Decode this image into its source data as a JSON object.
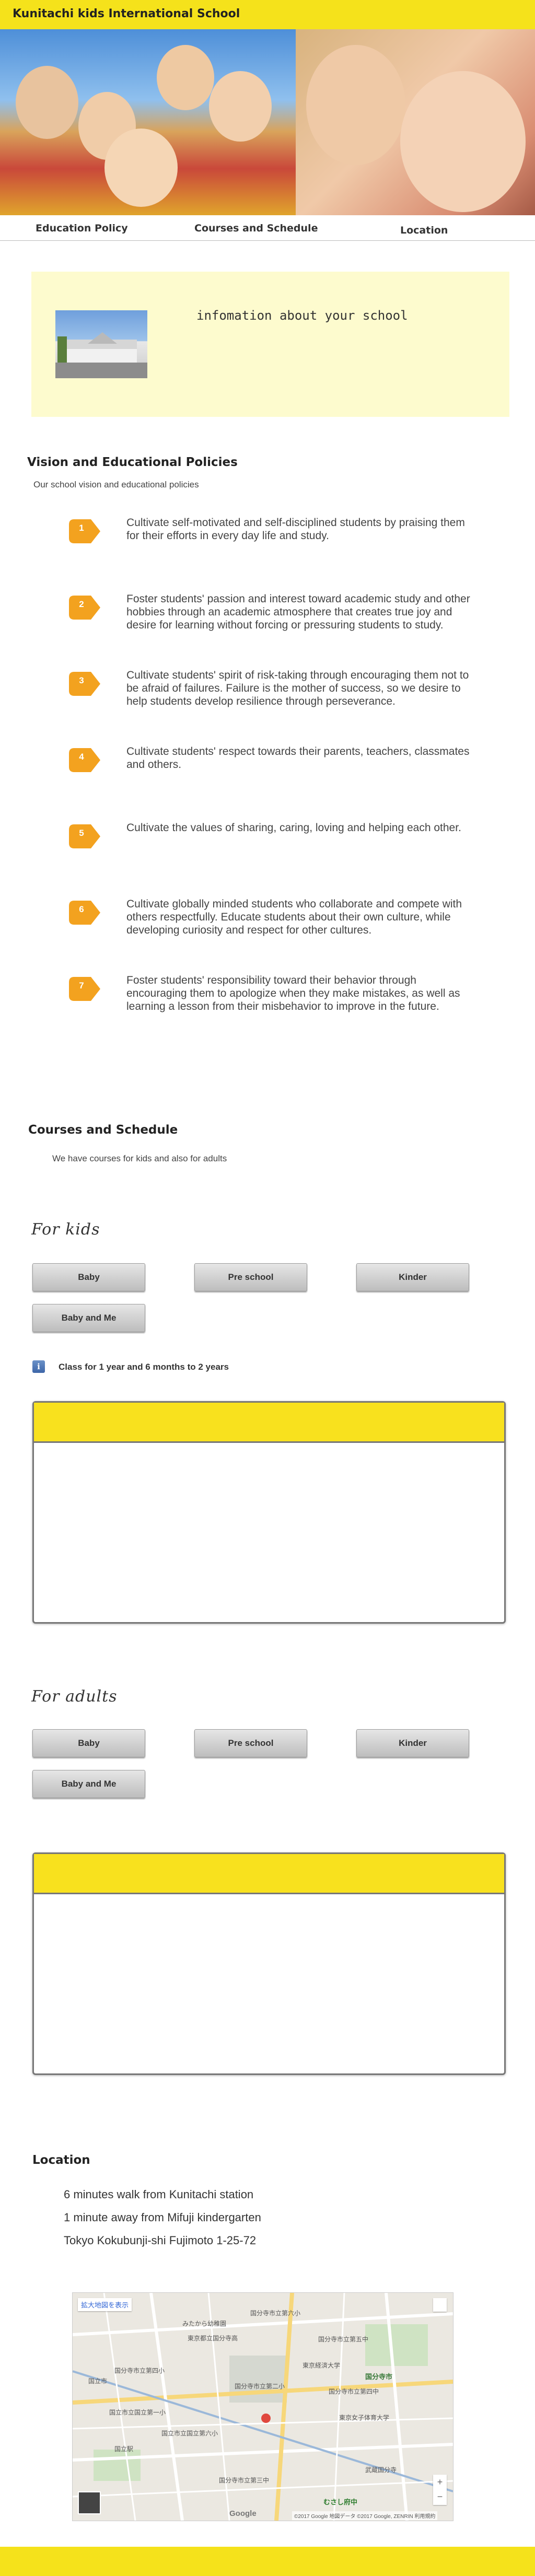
{
  "header": {
    "title": "Kunitachi kids International School"
  },
  "nav": {
    "items": [
      "Education Policy",
      "Courses and Schedule",
      "Location"
    ]
  },
  "info": {
    "text": "infomation about your school"
  },
  "vision": {
    "title": "Vision and Educational Policies",
    "subtitle": "Our school vision and educational policies",
    "items": [
      {
        "num": "1",
        "text": "Cultivate self-motivated and self-disciplined students by praising them for their efforts in every day life and study."
      },
      {
        "num": "2",
        "text": "Foster students' passion and interest toward academic study and other hobbies through an academic atmosphere that creates true joy and desire for learning without forcing or pressuring students to study."
      },
      {
        "num": "3",
        "text": "Cultivate students' spirit of risk-taking through encouraging them not to be afraid of failures. Failure is the mother of success, so we desire to help students develop resilience through perseverance."
      },
      {
        "num": "4",
        "text": "Cultivate students' respect towards their parents, teachers, classmates and others."
      },
      {
        "num": "5",
        "text": "Cultivate the values of sharing, caring, loving and helping each other."
      },
      {
        "num": "6",
        "text": "Cultivate globally minded students who collaborate and compete with others respectfully. Educate students about their own culture, while developing curiosity and respect for other cultures."
      },
      {
        "num": "7",
        "text": "Foster students' responsibility toward their behavior through encouraging them to apologize when they make mistakes, as well as learning a lesson from their misbehavior to improve in the future."
      }
    ],
    "badge_color": "#f3a21f"
  },
  "courses": {
    "title": "Courses and Schedule",
    "subtitle": "We have courses for kids and also for adults",
    "kids_heading": "For kids",
    "adults_heading": "For adults",
    "tabs": [
      "Baby",
      "Pre school",
      "Kinder",
      "Baby and Me"
    ],
    "class_note": "Class for 1 year and 6 months to 2 years",
    "accent": "#f8e11e"
  },
  "location": {
    "title": "Location",
    "lines": [
      "6 minutes walk from Kunitachi station",
      "1 minute away from Mifuji kindergarten",
      "Tokyo Kokubunji-shi Fujimoto 1-25-72"
    ],
    "map": {
      "labels": [
        "拡大地図を表示",
        "国分寺市立第六小",
        "みたから幼稚園",
        "東京都立国分寺高",
        "国分寺市立第五中",
        "国分寺市立第四小",
        "東京経済大学",
        "国立市",
        "国分寺市立第二小",
        "国分寺市立第四中",
        "国分寺市",
        "東京女子体育大学",
        "国立市立国立第一小",
        "国立市立国立第六小",
        "国立駅",
        "国分寺市立第三中",
        "武蔵国分寺",
        "むさし府中"
      ],
      "footer": "©2017 Google 地図データ ©2017 Google, ZENRIN  利用規約",
      "google": "Google"
    }
  }
}
